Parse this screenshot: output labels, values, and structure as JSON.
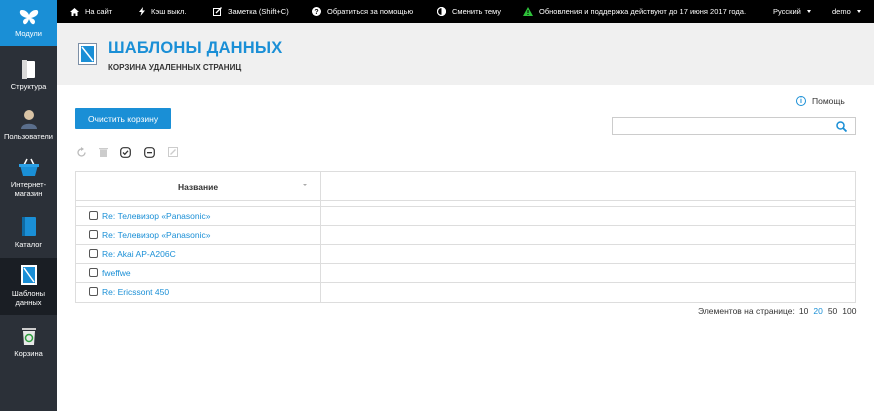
{
  "sidebar": {
    "items": [
      {
        "label": "Модули",
        "icon": "butterfly-icon"
      },
      {
        "label": "Структура",
        "icon": "document-icon"
      },
      {
        "label": "Пользователи",
        "icon": "user-icon"
      },
      {
        "label": "Интернет-\nмагазин",
        "label1": "Интернет-",
        "label2": "магазин",
        "icon": "basket-icon"
      },
      {
        "label": "Каталог",
        "icon": "book-icon"
      },
      {
        "label1": "Шаблоны",
        "label2": "данных",
        "icon": "template-icon"
      },
      {
        "label": "Корзина",
        "icon": "recycle-bin-icon"
      }
    ]
  },
  "topbar": {
    "site": "На сайт",
    "cache": "Кэш выкл.",
    "note": "Заметка (Shift+C)",
    "support": "Обратиться за помощью",
    "theme": "Сменить тему",
    "updates": "Обновления и поддержка действуют до 17 июня 2017 года.",
    "language": "Русский",
    "user": "demo"
  },
  "header": {
    "title": "ШАБЛОНЫ ДАННЫХ",
    "subtitle": "КОРЗИНА УДАЛЕННЫХ СТРАНИЦ"
  },
  "help_label": "Помощь",
  "clear_button": "Очистить корзину",
  "search": {
    "value": "",
    "placeholder": ""
  },
  "table": {
    "header": "Название",
    "rows": [
      {
        "name": "Re: Телевизор «Panasonic»"
      },
      {
        "name": "Re: Телевизор «Panasonic»"
      },
      {
        "name": "Re: Akai AP-A206C"
      },
      {
        "name": "fweffwe"
      },
      {
        "name": "Re: Ericssont 450"
      }
    ]
  },
  "pager": {
    "label": "Элементов на странице:",
    "options": [
      "10",
      "20",
      "50",
      "100"
    ],
    "selected": "20"
  },
  "colors": {
    "accent": "#1a8fd6",
    "sidebar": "#2b3038",
    "topbar": "#000000"
  }
}
